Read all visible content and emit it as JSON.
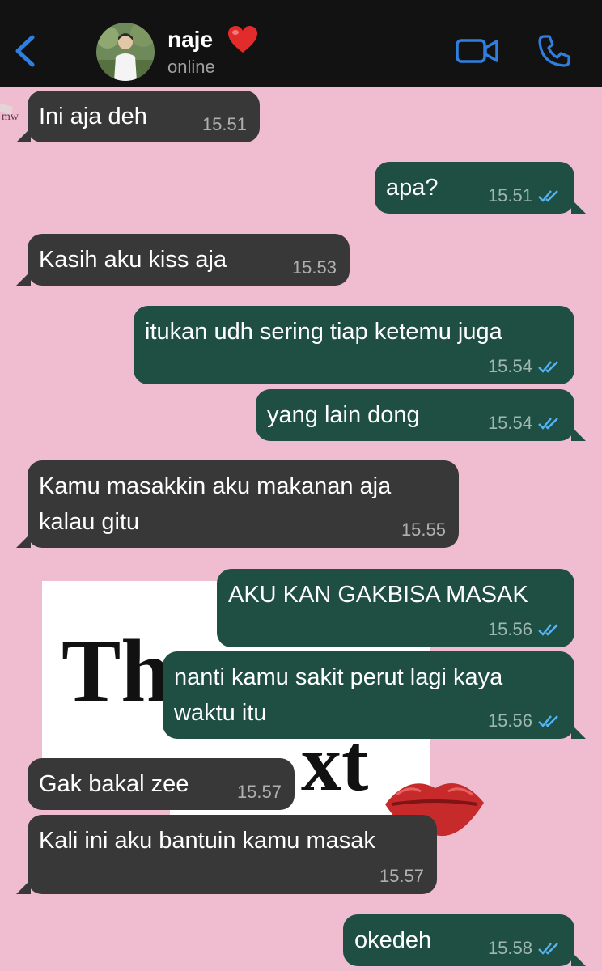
{
  "header": {
    "contact_name": "naje",
    "status": "online"
  },
  "colors": {
    "header_bg": "#121212",
    "accent_blue": "#2f7fe0",
    "wallpaper_pink": "#f0bdd0",
    "incoming_bubble": "#383838",
    "outgoing_bubble": "#1f4f42",
    "read_tick": "#55b4f5"
  },
  "icons": {
    "back": "chevron-left-icon",
    "video": "video-camera-icon",
    "call": "phone-icon",
    "heart": "red-heart-emoji",
    "ticks": "double-check-icon"
  },
  "messages": [
    {
      "dir": "in",
      "text": "Ini aja deh",
      "time": "15.51"
    },
    {
      "dir": "out",
      "text": "apa?",
      "time": "15.51"
    },
    {
      "dir": "in",
      "text": "Kasih aku kiss aja",
      "time": "15.53"
    },
    {
      "dir": "out",
      "text": "itukan udh sering tiap ketemu juga",
      "time": "15.54"
    },
    {
      "dir": "out",
      "text": "yang lain dong",
      "time": "15.54"
    },
    {
      "dir": "in",
      "text": "Kamu masakkin aku makanan aja\nkalau gitu",
      "time": "15.55"
    },
    {
      "dir": "out",
      "text": "AKU KAN GAKBISA MASAK",
      "time": "15.56"
    },
    {
      "dir": "out",
      "text": "nanti kamu sakit perut lagi kaya\nwaktu itu",
      "time": "15.56"
    },
    {
      "dir": "in",
      "text": "Gak bakal zee",
      "time": "15.57"
    },
    {
      "dir": "in",
      "text": "Kali ini aku bantuin kamu masak",
      "time": "15.57"
    },
    {
      "dir": "out",
      "text": "okedeh",
      "time": "15.58"
    }
  ]
}
